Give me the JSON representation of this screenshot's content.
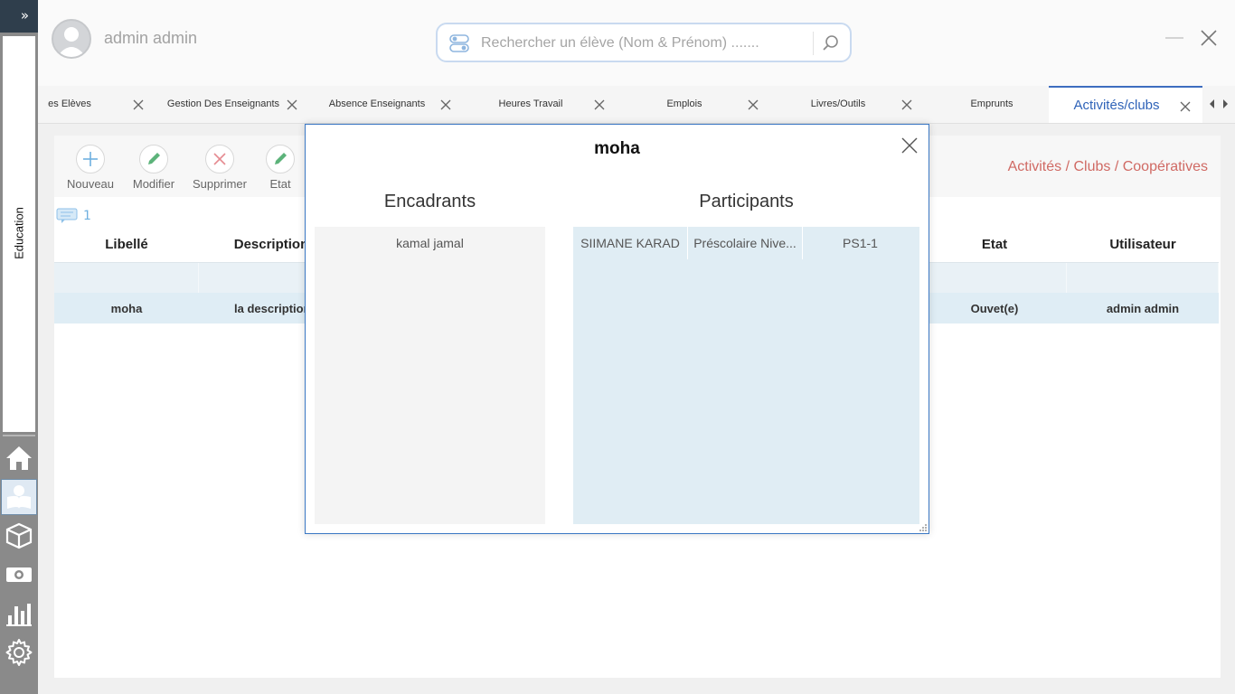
{
  "sidebar": {
    "toggle_label": "»",
    "section_label": "Education",
    "icons": [
      {
        "name": "home-icon"
      },
      {
        "name": "student-icon"
      },
      {
        "name": "box-icon"
      },
      {
        "name": "money-icon"
      },
      {
        "name": "chart-icon"
      },
      {
        "name": "settings-icon"
      }
    ]
  },
  "header": {
    "user_name": "admin admin",
    "search_placeholder": "Rechercher un élève (Nom & Prénom) ......."
  },
  "tabs": [
    {
      "label": "es Elèves",
      "active": false
    },
    {
      "label": "Gestion Des Enseignants",
      "active": false
    },
    {
      "label": "Absence Enseignants",
      "active": false
    },
    {
      "label": "Heures Travail",
      "active": false
    },
    {
      "label": "Emplois",
      "active": false
    },
    {
      "label": "Livres/Outils",
      "active": false
    },
    {
      "label": "Emprunts",
      "active": false
    },
    {
      "label": "Activités/clubs",
      "active": true
    }
  ],
  "toolbar": {
    "new_label": "Nouveau",
    "edit_label": "Modifier",
    "delete_label": "Supprimer",
    "state_label": "Etat"
  },
  "page_title": "Activités / Clubs / Coopératives",
  "record_count": "1",
  "grid": {
    "columns": {
      "libelle": "Libellé",
      "description": "Description",
      "etat": "Etat",
      "utilisateur": "Utilisateur"
    },
    "rows": [
      {
        "libelle": "moha",
        "description": "la description",
        "etat": "Ouvet(e)",
        "utilisateur": "admin admin"
      }
    ]
  },
  "modal": {
    "title": "moha",
    "encadrants_title": "Encadrants",
    "participants_title": "Participants",
    "encadrants": [
      "kamal jamal"
    ],
    "participants": [
      {
        "name": "SIIMANE KARAD",
        "level": "Préscolaire Nive...",
        "class": "PS1-1"
      }
    ]
  },
  "colors": {
    "accent": "#2f63b8",
    "title_red": "#d06a64",
    "sidebar_bg": "#8a8a8a",
    "selection_blue": "#dfedf5"
  }
}
